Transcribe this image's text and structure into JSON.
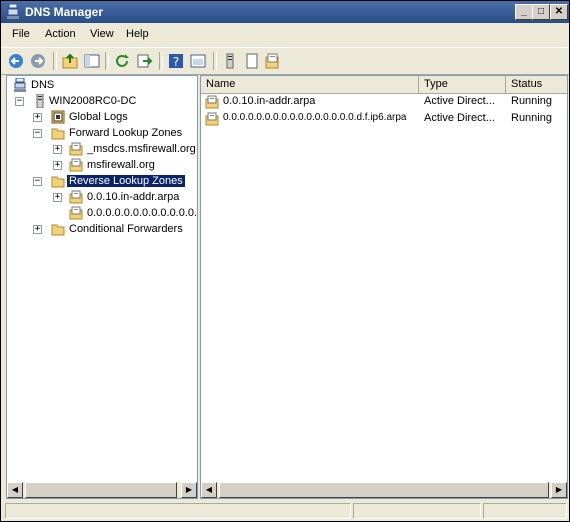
{
  "window": {
    "title": "DNS Manager"
  },
  "titlebar_buttons": {
    "minimize": "_",
    "maximize": "□",
    "close": "✕"
  },
  "menu": {
    "items": [
      "File",
      "Action",
      "View",
      "Help"
    ]
  },
  "toolbar": {
    "icons": [
      "back-icon",
      "forward-icon",
      "up-folder-icon",
      "show-hide-tree-icon",
      "refresh-icon",
      "export-list-icon",
      "help-icon",
      "properties-icon",
      "server-icon",
      "new-zone-icon",
      "zone-icon"
    ]
  },
  "tree": {
    "root": "DNS",
    "server": "WIN2008RC0-DC",
    "global_logs": "Global Logs",
    "forward": "Forward Lookup Zones",
    "forward_zones": [
      "_msdcs.msfirewall.org",
      "msfirewall.org"
    ],
    "reverse": "Reverse Lookup Zones",
    "reverse_zones": [
      "0.0.10.in-addr.arpa",
      "0.0.0.0.0.0.0.0.0.0.0.0.0.0.0.0.d.f.ip6.arpa"
    ],
    "conditional": "Conditional Forwarders",
    "expander_plus": "+",
    "expander_minus": "−"
  },
  "list": {
    "columns": [
      "Name",
      "Type",
      "Status"
    ],
    "rows": [
      {
        "name": "0.0.10.in-addr.arpa",
        "type": "Active Direct...",
        "status": "Running"
      },
      {
        "name": "0.0.0.0.0.0.0.0.0.0.0.0.0.0.0.0.d.f.ip6.arpa",
        "type": "Active Direct...",
        "status": "Running"
      }
    ]
  },
  "scroll": {
    "left": "◀",
    "right": "▶"
  },
  "colors": {
    "title_bar": "#2a4d86",
    "selection": "#0a246a",
    "folder": "#f3d27a"
  }
}
